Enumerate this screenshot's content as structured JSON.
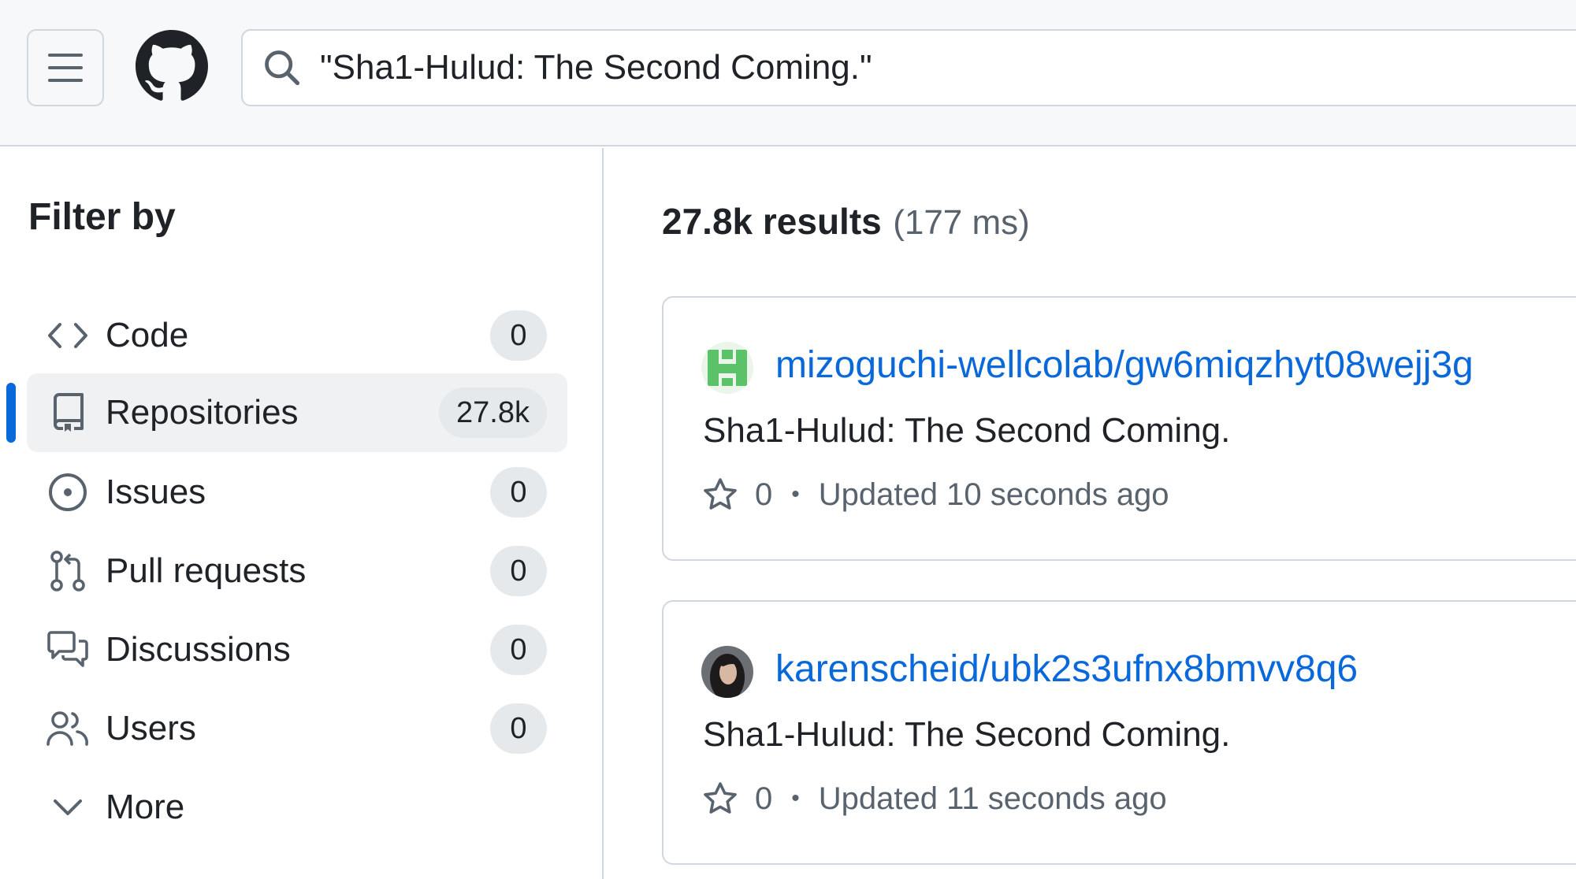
{
  "header": {
    "menu_icon": "hamburger-icon",
    "logo_icon": "github-logo-icon",
    "search_icon": "search-icon",
    "search_query": "\"Sha1-Hulud: The Second Coming.\""
  },
  "sidebar": {
    "title": "Filter by",
    "items": [
      {
        "label": "Code",
        "count": "0",
        "icon": "code-icon"
      },
      {
        "label": "Repositories",
        "count": "27.8k",
        "icon": "repo-icon",
        "selected": true
      },
      {
        "label": "Issues",
        "count": "0",
        "icon": "issue-icon"
      },
      {
        "label": "Pull requests",
        "count": "0",
        "icon": "pull-request-icon"
      },
      {
        "label": "Discussions",
        "count": "0",
        "icon": "discussions-icon"
      },
      {
        "label": "Users",
        "count": "0",
        "icon": "users-icon"
      },
      {
        "label": "More",
        "icon": "chevron-down-icon"
      }
    ]
  },
  "results": {
    "count": "27.8k results",
    "time": "(177 ms)",
    "items": [
      {
        "repo": "mizoguchi-wellcolab/gw6miqzhyt08wejj3g",
        "description": "Sha1-Hulud: The Second Coming.",
        "stars": "0",
        "updated": "Updated 10 seconds ago",
        "avatar": "identicon-green"
      },
      {
        "repo": "karenscheid/ubk2s3ufnx8bmvv8q6",
        "description": "Sha1-Hulud: The Second Coming.",
        "stars": "0",
        "updated": "Updated 11 seconds ago",
        "avatar": "photo"
      }
    ]
  },
  "colors": {
    "accent": "#0969da",
    "text": "#1f2328",
    "muted": "#59636e",
    "border": "#d0d7de",
    "header_bg": "#f6f8fa",
    "selected_bg": "#eff1f3",
    "count_bg": "#e6e9ec"
  }
}
